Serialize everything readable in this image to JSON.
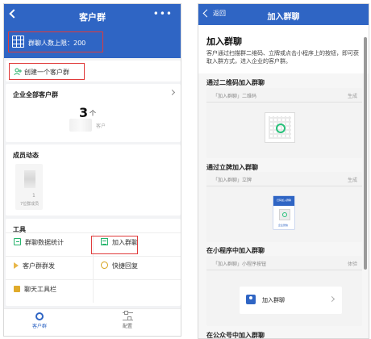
{
  "left_screen": {
    "title": "客户群",
    "more_label": "•••",
    "group_limit_label": "群聊人数上限：200",
    "create_group_label": "创建一个客户群",
    "all_groups": {
      "title": "企业全部客户群",
      "count": "3",
      "unit": "个",
      "caption": "客户"
    },
    "member_activity": {
      "title": "成员动态",
      "tile_count": "1",
      "tile_caption": "7位群成员"
    },
    "tools": {
      "title": "工具",
      "items": [
        {
          "label": "群聊数据统计",
          "icon": "chart-icon"
        },
        {
          "label": "加入群聊",
          "icon": "invite-icon"
        },
        {
          "label": "客户群群发",
          "icon": "megaphone-icon"
        },
        {
          "label": "快捷回复",
          "icon": "reply-icon"
        },
        {
          "label": "聊天工具栏",
          "icon": "toolbar-icon"
        }
      ]
    },
    "tabs": [
      {
        "label": "客户群",
        "icon": "people-icon"
      },
      {
        "label": "配置",
        "icon": "settings-sliders-icon"
      }
    ]
  },
  "right_screen": {
    "title": "加入群聊",
    "back_label": "返回",
    "heading": "加入群聊",
    "description": "客户通过扫描群二维码、立牌或点击小程序上的按钮，即可获取入群方式，进入企业的客户群。",
    "sections": [
      {
        "title": "通过二维码加入群聊",
        "card_label": "「加入群聊」二维码",
        "action": "生成"
      },
      {
        "title": "通过立牌加入群聊",
        "card_label": "「加入群聊」立牌",
        "action": "生成",
        "standee_text": "扫码加入群聊",
        "standee_footer": "企业微信"
      },
      {
        "title": "在小程序中加入群聊",
        "card_label": "「加入群聊」小程序按钮",
        "action": "体验",
        "button_label": "加入群聊"
      },
      {
        "title": "在公众号中加入群聊"
      }
    ]
  }
}
